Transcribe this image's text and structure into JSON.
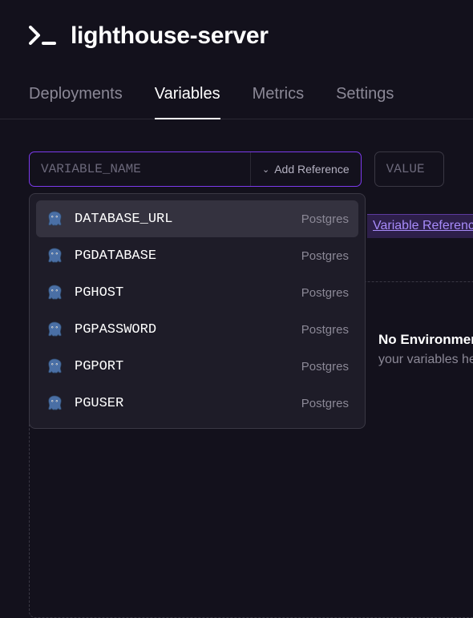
{
  "header": {
    "title": "lighthouse-server"
  },
  "tabs": [
    {
      "label": "Deployments",
      "active": false
    },
    {
      "label": "Variables",
      "active": true
    },
    {
      "label": "Metrics",
      "active": false
    },
    {
      "label": "Settings",
      "active": false
    }
  ],
  "inputs": {
    "variable_name_placeholder": "VARIABLE_NAME",
    "add_reference_label": "Add Reference",
    "value_placeholder": "VALUE or ${{REFERENCE}}"
  },
  "dropdown": {
    "items": [
      {
        "name": "DATABASE_URL",
        "source": "Postgres",
        "active": true
      },
      {
        "name": "PGDATABASE",
        "source": "Postgres",
        "active": false
      },
      {
        "name": "PGHOST",
        "source": "Postgres",
        "active": false
      },
      {
        "name": "PGPASSWORD",
        "source": "Postgres",
        "active": false
      },
      {
        "name": "PGPORT",
        "source": "Postgres",
        "active": false
      },
      {
        "name": "PGUSER",
        "source": "Postgres",
        "active": false
      }
    ]
  },
  "link": {
    "label": "Variable References"
  },
  "empty_state": {
    "title": "No Environment Variables",
    "subtitle": "your variables here"
  }
}
